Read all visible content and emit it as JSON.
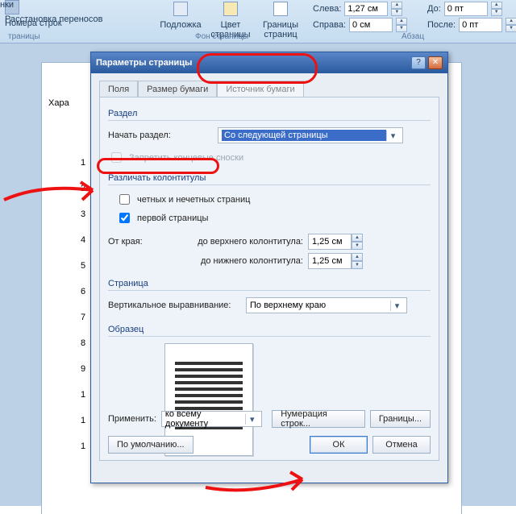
{
  "ribbon": {
    "line_numbers": "Номера строк",
    "links": "нки",
    "hyphenation": "Расстановка переносов",
    "group_page": "траницы",
    "watermark": "Подложка",
    "page_color": "Цвет\nстраницы",
    "page_borders": "Границы\nстраниц",
    "group_bg": "Фон страницы",
    "left_lbl": "Слева:",
    "right_lbl": "Справа:",
    "left_val": "1,27 см",
    "right_val": "0 см",
    "before_lbl": "До:",
    "after_lbl": "После:",
    "before_val": "0 пт",
    "after_val": "0 пт",
    "group_para": "Абзац"
  },
  "page": {
    "text1": "Хара",
    "nums": [
      "1",
      "2",
      "3",
      "4",
      "5",
      "6",
      "7",
      "8",
      "9",
      "1",
      "1",
      "1"
    ]
  },
  "dialog": {
    "title": "Параметры страницы",
    "tabs": {
      "fields": "Поля",
      "paper": "Размер бумаги",
      "source": "Источник бумаги"
    },
    "section": {
      "title": "Раздел",
      "start_label": "Начать раздел:",
      "start_value": "Со следующей страницы",
      "suppress": "Запретить концевые сноски"
    },
    "headers": {
      "title": "Различать колонтитулы",
      "odd_even": "четных и нечетных страниц",
      "first_page": "первой страницы",
      "from_edge": "От края:",
      "to_header": "до верхнего колонтитула:",
      "to_footer": "до нижнего колонтитула:",
      "header_val": "1,25 см",
      "footer_val": "1,25 см"
    },
    "page_grp": {
      "title": "Страница",
      "valign_label": "Вертикальное выравнивание:",
      "valign_value": "По верхнему краю"
    },
    "sample": "Образец",
    "apply_label": "Применить:",
    "apply_value": "ко всему документу",
    "btn_linenum": "Нумерация строк...",
    "btn_borders": "Границы...",
    "btn_default": "По умолчанию...",
    "btn_ok": "ОК",
    "btn_cancel": "Отмена"
  }
}
